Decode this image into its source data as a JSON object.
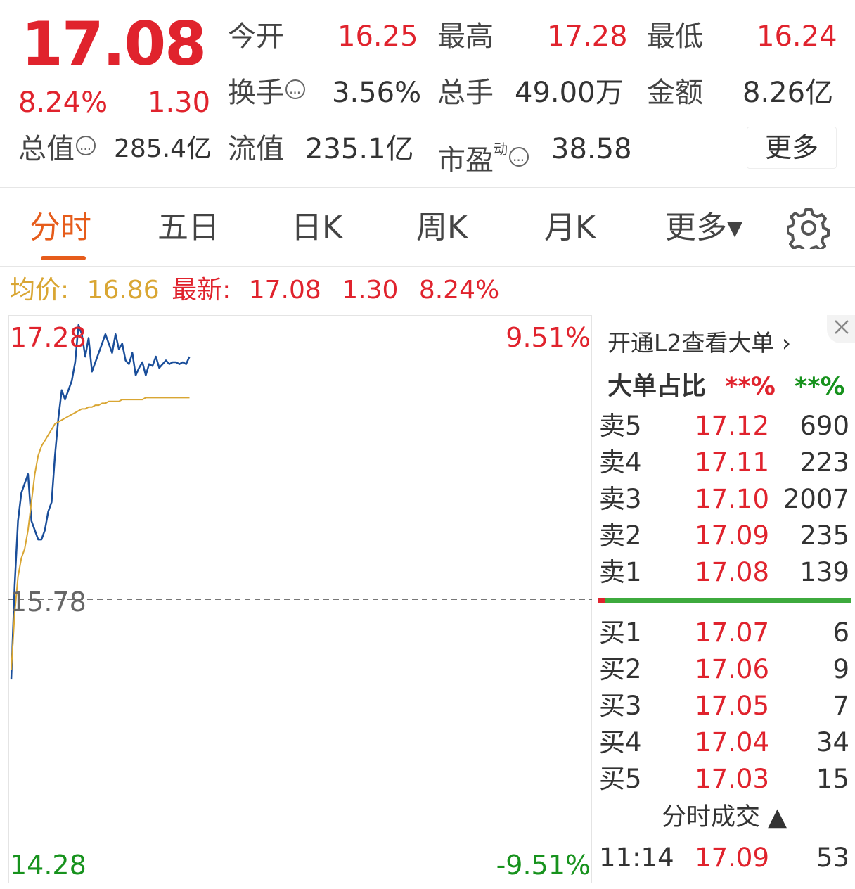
{
  "quote": {
    "price": "17.08",
    "change_pct": "8.24%",
    "change": "1.30",
    "open_label": "今开",
    "open": "16.25",
    "high_label": "最高",
    "high": "17.28",
    "low_label": "最低",
    "low": "16.24",
    "turnover_label": "换手",
    "turnover": "3.56%",
    "volume_label": "总手",
    "volume": "49.00万",
    "amount_label": "金额",
    "amount": "8.26亿",
    "mktcap_label": "总值",
    "mktcap": "285.4亿",
    "float_label": "流值",
    "float": "235.1亿",
    "pe_label": "市盈",
    "pe_sup": "动",
    "pe": "38.58",
    "more_label": "更多"
  },
  "tabs": [
    {
      "label": "分时",
      "active": true
    },
    {
      "label": "五日"
    },
    {
      "label": "日K"
    },
    {
      "label": "周K"
    },
    {
      "label": "月K"
    },
    {
      "label": "更多▾"
    }
  ],
  "avgbar": {
    "avg_label": "均价:",
    "avg": "16.86",
    "latest_label": "最新:",
    "latest": "17.08",
    "change": "1.30",
    "change_pct": "8.24%"
  },
  "chart_data": {
    "type": "line",
    "y_top_label": "17.28",
    "y_mid_label": "15.78",
    "y_bottom_label": "14.28",
    "pct_top_label": "9.51%",
    "pct_bottom_label": "-9.51%",
    "ylim": [
      14.28,
      17.28
    ],
    "prev_close": 15.78,
    "x_points_total": 240,
    "series": [
      {
        "color": "#1a4e9a",
        "values": [
          15.35,
          15.85,
          16.2,
          16.35,
          16.4,
          16.45,
          16.2,
          16.15,
          16.1,
          16.1,
          16.15,
          16.25,
          16.3,
          16.55,
          16.75,
          16.9,
          16.85,
          16.9,
          16.95,
          17.05,
          17.25,
          17.2,
          17.08,
          17.18,
          17.0,
          17.05,
          17.1,
          17.15,
          17.2,
          17.15,
          17.1,
          17.2,
          17.12,
          17.15,
          17.06,
          17.04,
          17.1,
          16.98,
          17.02,
          17.05,
          16.98,
          17.04,
          17.03,
          17.08,
          17.02,
          17.04,
          17.06,
          17.04,
          17.05,
          17.05,
          17.04,
          17.05,
          17.04,
          17.08
        ]
      },
      {
        "color": "#d9a633",
        "values": [
          15.4,
          15.7,
          15.9,
          16.0,
          16.05,
          16.15,
          16.3,
          16.45,
          16.55,
          16.6,
          16.63,
          16.66,
          16.69,
          16.72,
          16.73,
          16.74,
          16.75,
          16.76,
          16.77,
          16.78,
          16.79,
          16.8,
          16.8,
          16.81,
          16.81,
          16.82,
          16.82,
          16.83,
          16.83,
          16.84,
          16.84,
          16.84,
          16.84,
          16.85,
          16.85,
          16.85,
          16.85,
          16.85,
          16.85,
          16.85,
          16.86,
          16.86,
          16.86,
          16.86,
          16.86,
          16.86,
          16.86,
          16.86,
          16.86,
          16.86,
          16.86,
          16.86,
          16.86,
          16.86
        ]
      }
    ]
  },
  "orderbook": {
    "l2_label": "开通L2查看大单 ›",
    "big_order_label": "大单占比",
    "big_red": "**%",
    "big_green": "**%",
    "asks": [
      {
        "label": "卖5",
        "price": "17.12",
        "vol": "690"
      },
      {
        "label": "卖4",
        "price": "17.11",
        "vol": "223"
      },
      {
        "label": "卖3",
        "price": "17.10",
        "vol": "2007"
      },
      {
        "label": "卖2",
        "price": "17.09",
        "vol": "235"
      },
      {
        "label": "卖1",
        "price": "17.08",
        "vol": "139"
      }
    ],
    "bids": [
      {
        "label": "买1",
        "price": "17.07",
        "vol": "6"
      },
      {
        "label": "买2",
        "price": "17.06",
        "vol": "9"
      },
      {
        "label": "买3",
        "price": "17.05",
        "vol": "7"
      },
      {
        "label": "买4",
        "price": "17.04",
        "vol": "34"
      },
      {
        "label": "买5",
        "price": "17.03",
        "vol": "15"
      }
    ],
    "ticks_label": "分时成交 ▲",
    "ticks": [
      {
        "time": "11:14",
        "price": "17.09",
        "vol": "53"
      }
    ]
  }
}
